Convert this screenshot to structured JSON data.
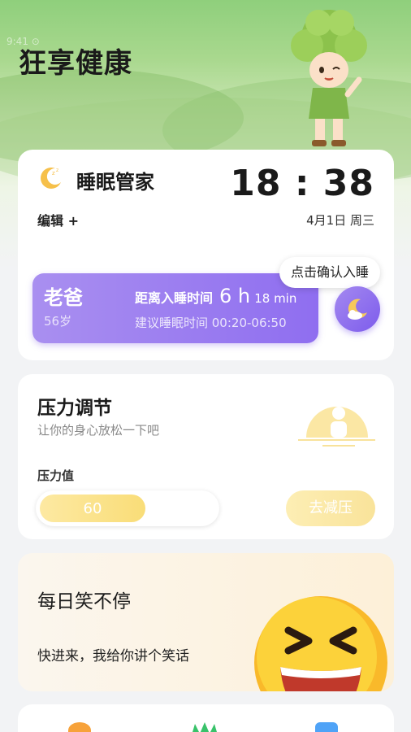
{
  "status_bar": {
    "text": "9:41 ⊙"
  },
  "header": {
    "title": "狂享健康"
  },
  "sleep": {
    "title": "睡眠管家",
    "edit_label": "编辑 +",
    "time": "18 : 38",
    "date": "4月1日  周三",
    "confirm_label": "点击确认入睡",
    "person": {
      "name": "老爸",
      "age": "56岁",
      "countdown_label": "距离入睡时间",
      "hours": "6 h",
      "minutes": "18 min",
      "suggest": "建议睡眠时间  00:20-06:50"
    }
  },
  "stress": {
    "title": "压力调节",
    "subtitle": "让你的身心放松一下吧",
    "value_label": "压力值",
    "value": "60",
    "value_fraction": 0.6,
    "button_label": "去减压"
  },
  "joke": {
    "title": "每日笑不停",
    "subtitle": "快进来，我给你讲个笑话"
  },
  "colors": {
    "accent_purple": "#8f6ef0",
    "accent_yellow": "#f9dd78",
    "hero_green": "#8fcf7c"
  }
}
